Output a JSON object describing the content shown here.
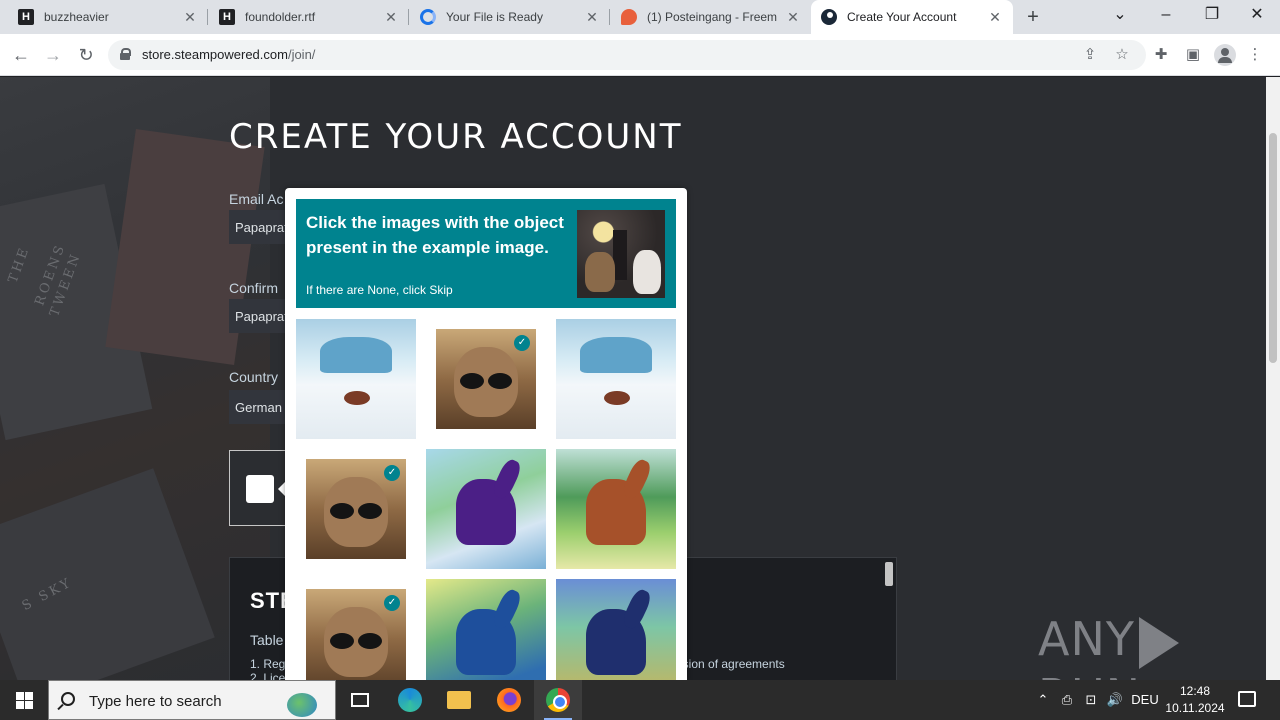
{
  "tabs": [
    {
      "title": "buzzheavier",
      "favicon": "h-icon"
    },
    {
      "title": "foundolder.rtf",
      "favicon": "h-icon"
    },
    {
      "title": "Your File is Ready",
      "favicon": "loading-icon"
    },
    {
      "title": "(1) Posteingang - Freem",
      "favicon": "mail-icon"
    },
    {
      "title": "Create Your Account",
      "favicon": "steam-icon",
      "active": true
    }
  ],
  "address": {
    "host": "store.steampowered.com",
    "path": "/join/"
  },
  "page": {
    "heading": "CREATE YOUR ACCOUNT",
    "email_label": "Email Ac",
    "email_value": "Papaprat",
    "confirm_label": "Confirm",
    "confirm_value": "Papaprat",
    "country_label": "Country",
    "country_value": "German",
    "ssa_title": "STE",
    "ssa_sub": "Table",
    "ssa_item1": "1. Reg",
    "ssa_item2": "2. Lice",
    "ssa_right": "usion of agreements",
    "bg_text_1": "THE",
    "bg_text_2": "ROENS",
    "bg_text_3": "TWEEN",
    "bg_text_4": "S SKY"
  },
  "captcha": {
    "prompt": "Click the images with the object present in the example image.",
    "hint": "If there are None, click Skip",
    "check_mark": "✓",
    "tiles": [
      {
        "name": "snow-crab-image",
        "style": "snow",
        "selected": false
      },
      {
        "name": "cat-sunglasses-image",
        "style": "cat",
        "selected": true
      },
      {
        "name": "snow-crab-image-2",
        "style": "snow",
        "selected": false
      },
      {
        "name": "cat-sunglasses-image-2",
        "style": "cat",
        "selected": true
      },
      {
        "name": "purple-horse-image",
        "style": "horse-purple",
        "selected": false
      },
      {
        "name": "brown-horse-image",
        "style": "horse-green",
        "selected": false
      },
      {
        "name": "cat-sunglasses-image-3",
        "style": "cat",
        "selected": true
      },
      {
        "name": "blue-horse-image",
        "style": "horse-blue",
        "selected": false
      },
      {
        "name": "dark-horse-image",
        "style": "horse-night",
        "selected": false
      }
    ]
  },
  "watermark": {
    "left": "ANY",
    "right": "RUN"
  },
  "taskbar": {
    "search_placeholder": "Type here to search",
    "lang": "DEU",
    "time": "12:48",
    "date": "10.11.2024"
  },
  "colors": {
    "accent": "#00838f",
    "page_bg": "#2b2d31"
  }
}
